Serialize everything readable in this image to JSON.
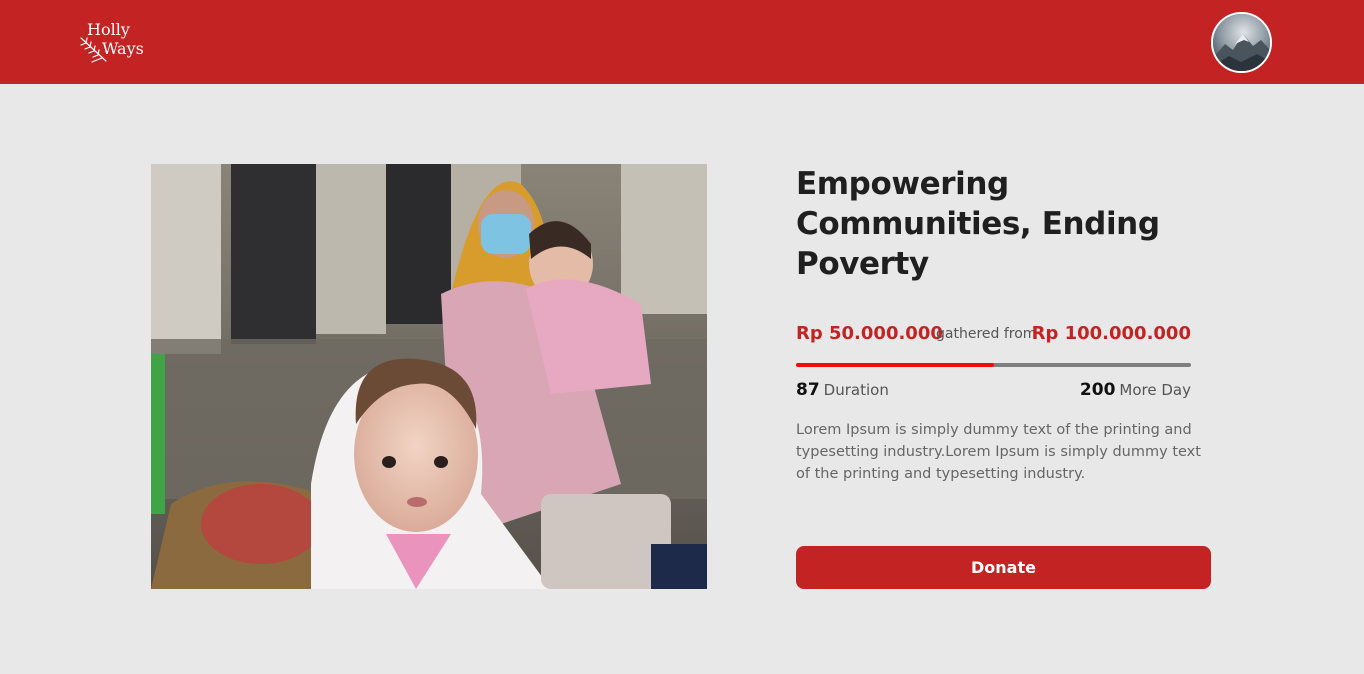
{
  "navbar": {
    "logo": {
      "line1": "Holly",
      "line2": "Ways"
    },
    "avatar": {
      "icon": "profile-avatar-icon"
    },
    "colors": {
      "brand": "#c42323"
    }
  },
  "campaign": {
    "title": "Empowering Communities, Ending Poverty",
    "image": "photo of a mother in a face mask holding a child, with a baby in the foreground",
    "gathered_amount": "Rp 50.000.000",
    "gathered_label": "gathered from",
    "target_amount": "Rp 100.000.000",
    "progress_fraction": 0.5,
    "duration_value": "87",
    "duration_label": "Duration",
    "days_left_value": "200",
    "days_left_label": "More Day",
    "description": "Lorem Ipsum is simply dummy text of the printing and typesetting industry.Lorem Ipsum is simply dummy text of the printing and typesetting industry.",
    "donate_label": "Donate"
  },
  "colors": {
    "accent": "#c42323",
    "progress_fill": "#f00c0c",
    "progress_track": "#7f7f7f",
    "page_background": "#e8e8e8"
  }
}
